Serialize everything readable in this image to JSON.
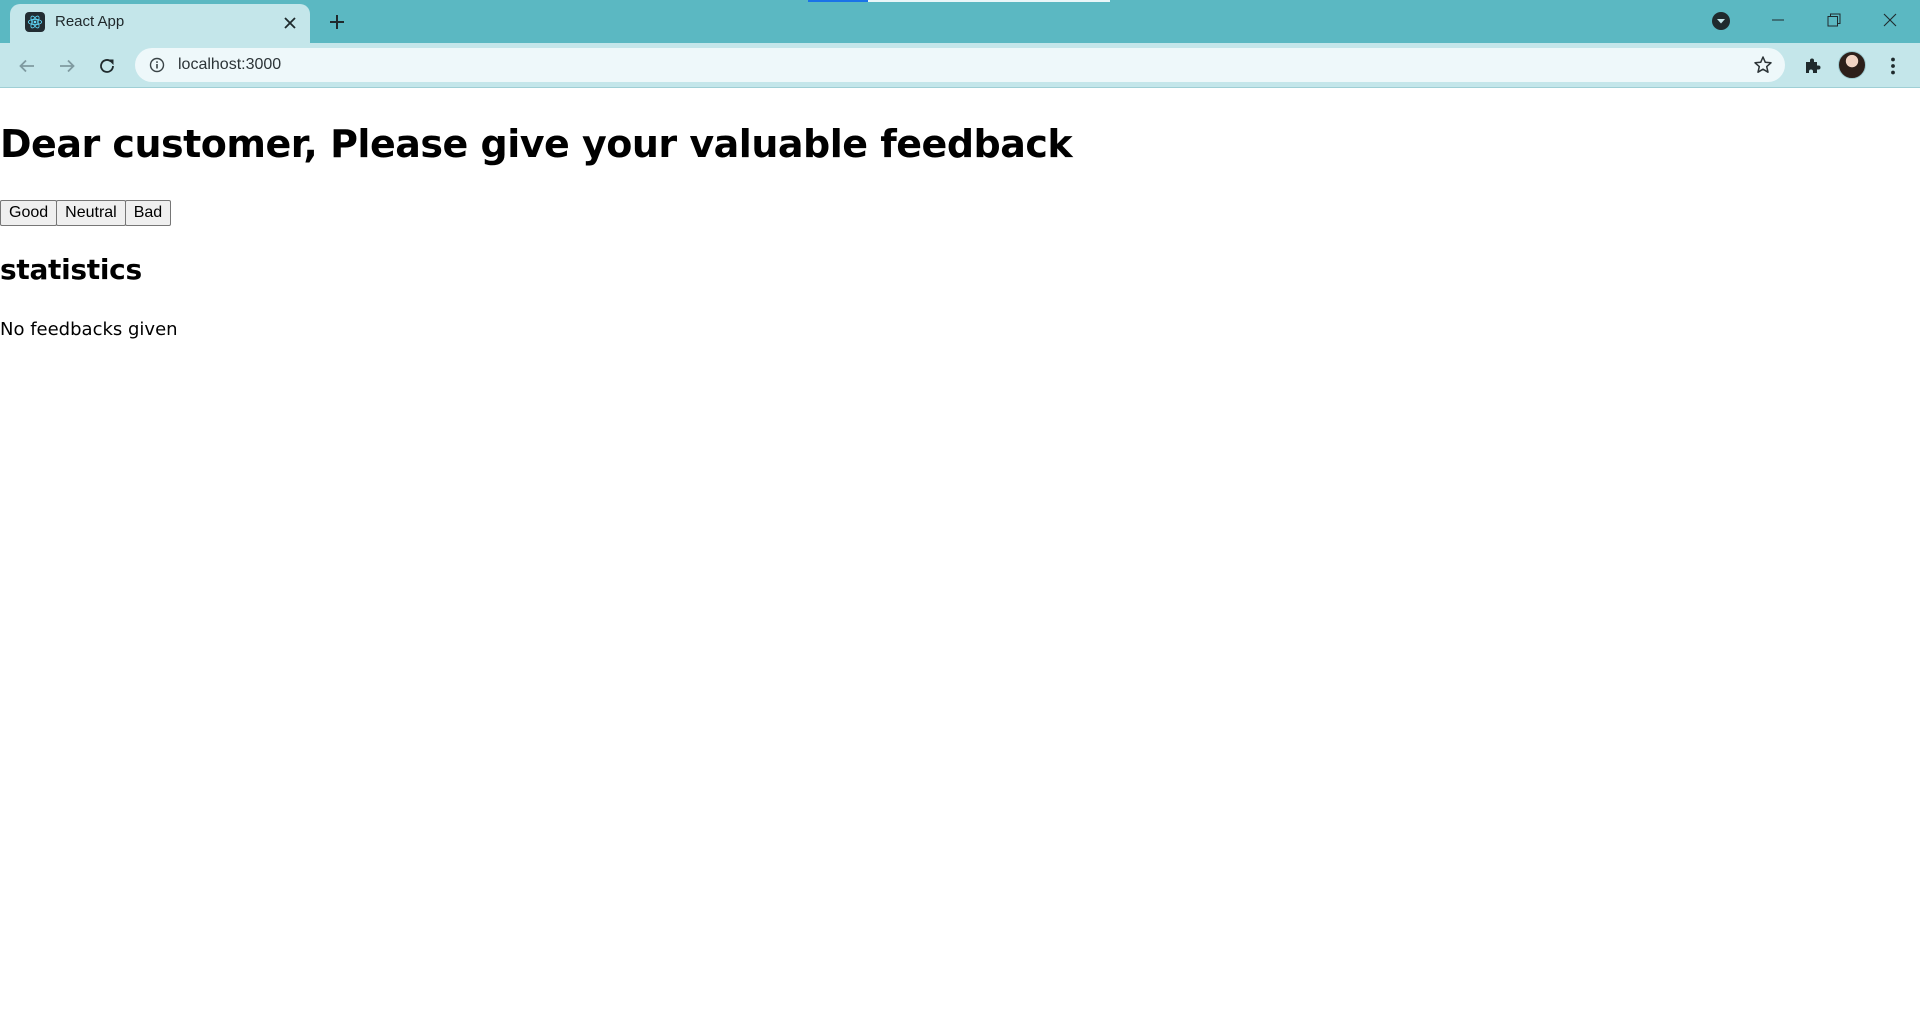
{
  "browser": {
    "tab": {
      "title": "React App",
      "favicon": "react-icon"
    },
    "address": {
      "url": "localhost:3000"
    },
    "colors": {
      "frame": "#5bb8c2",
      "toolbar": "#c4e6ea",
      "omnibox": "#eef8fa"
    }
  },
  "page": {
    "title": "Dear customer, Please give your valuable feedback",
    "buttons": {
      "good": "Good",
      "neutral": "Neutral",
      "bad": "Bad"
    },
    "statistics": {
      "heading": "statistics",
      "empty_message": "No feedbacks given"
    }
  }
}
